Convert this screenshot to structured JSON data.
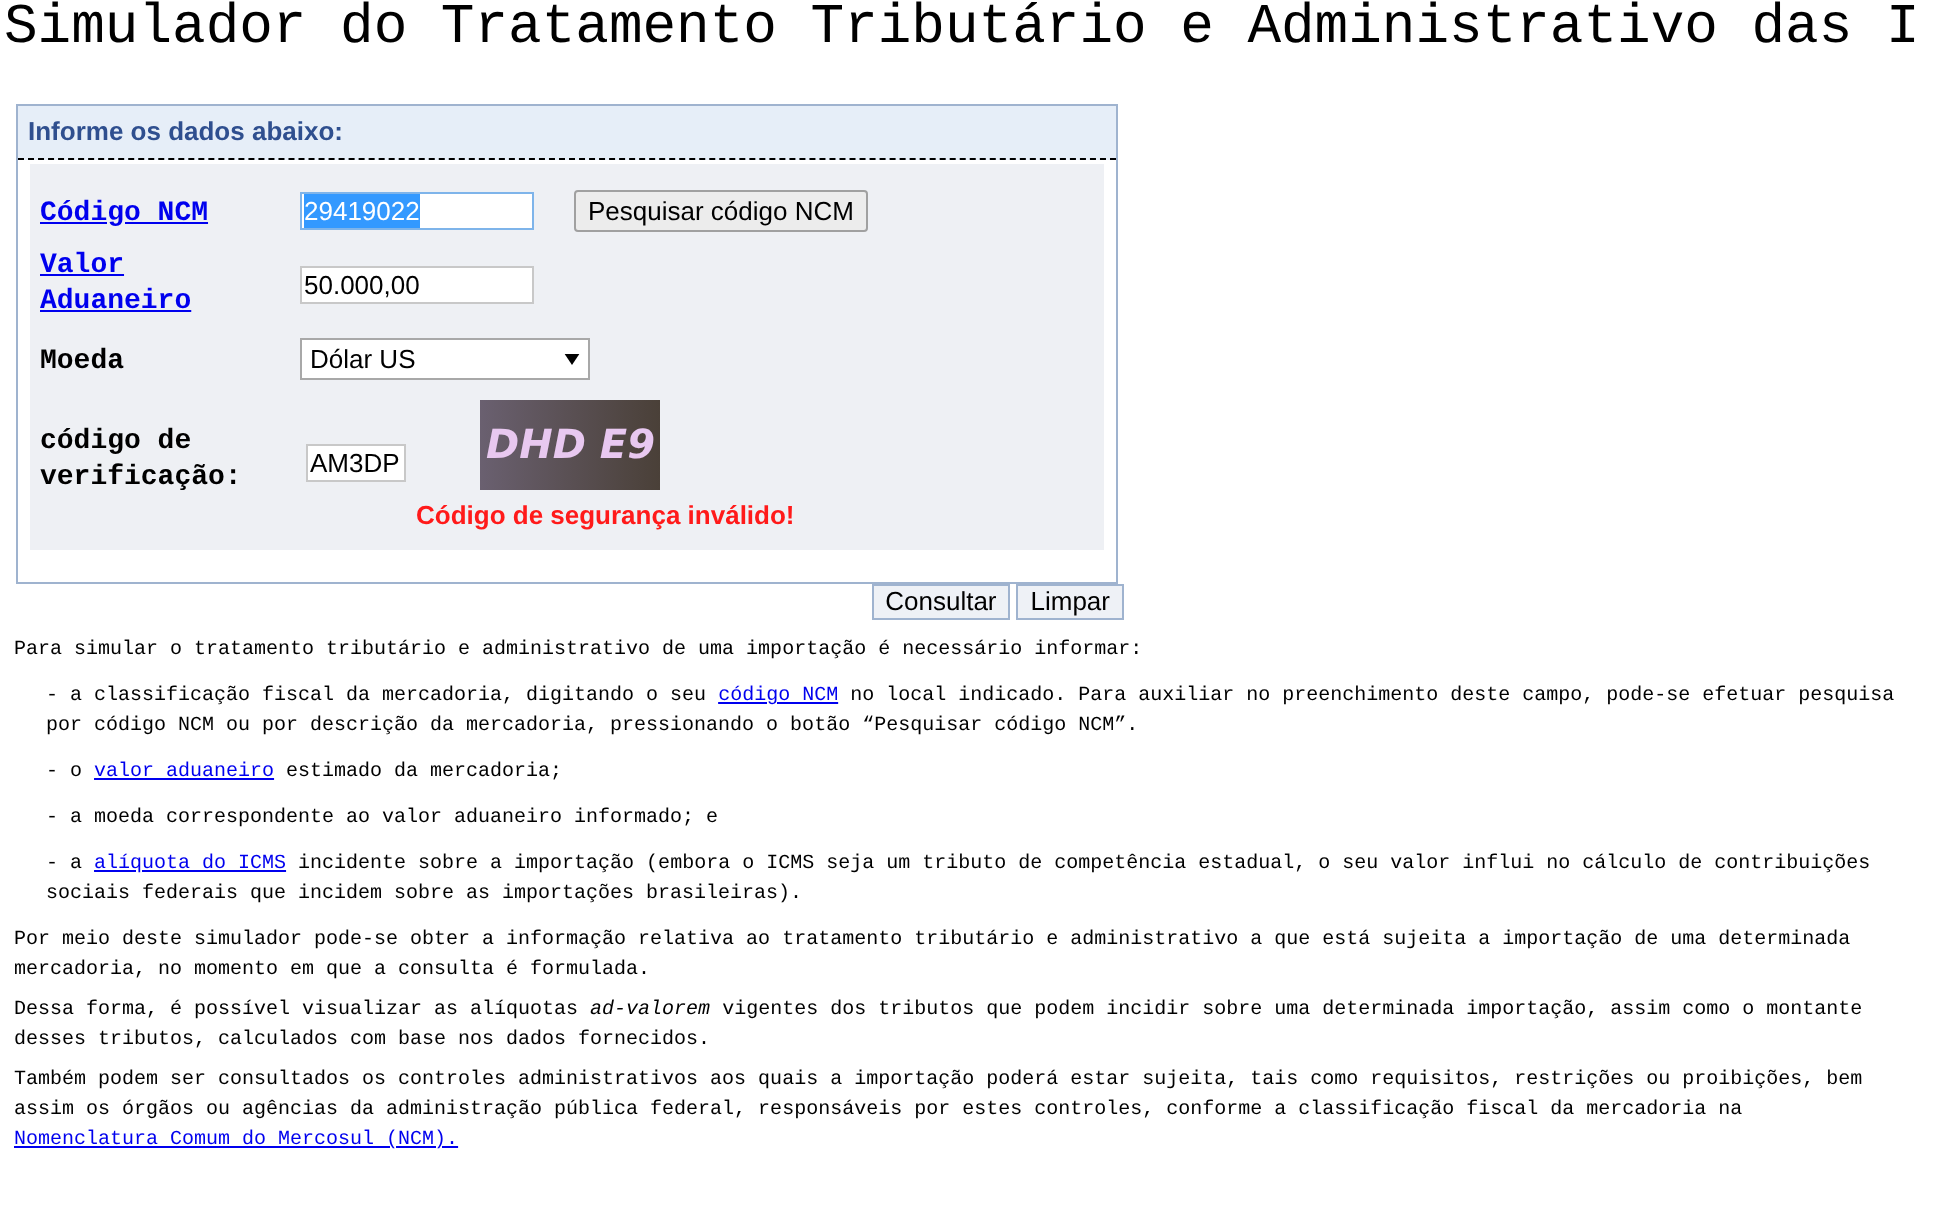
{
  "page_title": "Simulador do Tratamento Tributário e Administrativo das I",
  "form": {
    "header": "Informe os dados abaixo:",
    "fields": [
      {
        "kind": "text",
        "label": "Código NCM",
        "label_link": true,
        "value": "29419022",
        "selected": true,
        "button": "Pesquisar código NCM"
      },
      {
        "kind": "text",
        "label": "Valor Aduaneiro",
        "label_link": true,
        "value": "50.000,00",
        "selected": false
      },
      {
        "kind": "select",
        "label": "Moeda",
        "label_link": false,
        "value": "Dólar US"
      },
      {
        "kind": "captcha",
        "label": "código de verificação:",
        "label_link": false,
        "value": "AM3DP",
        "captcha_text": "DHD E9",
        "error": "Código de segurança inválido!"
      }
    ]
  },
  "buttons": [
    "Consultar",
    "Limpar"
  ],
  "intro": [
    {
      "kind": "text",
      "text": "Para simular o tratamento tributário e administrativo de uma importação é necessário informar:"
    }
  ],
  "bullets": [
    [
      {
        "kind": "text",
        "text": "- a classificação fiscal da mercadoria, digitando o seu "
      },
      {
        "kind": "link",
        "text": "código NCM"
      },
      {
        "kind": "text",
        "text": " no local indicado. Para auxiliar no preenchimento deste campo, pode-se efetuar pesquisa por código NCM ou por descrição da mercadoria, pressionando o botão “Pesquisar código NCM”."
      }
    ],
    [
      {
        "kind": "text",
        "text": "- o "
      },
      {
        "kind": "link",
        "text": "valor aduaneiro"
      },
      {
        "kind": "text",
        "text": " estimado da mercadoria;"
      }
    ],
    [
      {
        "kind": "text",
        "text": "- a moeda correspondente ao valor aduaneiro informado; e"
      }
    ],
    [
      {
        "kind": "text",
        "text": "- a "
      },
      {
        "kind": "link",
        "text": "alíquota do ICMS"
      },
      {
        "kind": "text",
        "text": " incidente sobre a importação (embora o ICMS seja um tributo de competência estadual, o seu valor influi no cálculo de contribuições sociais federais que incidem sobre as importações brasileiras)."
      }
    ]
  ],
  "paragraphs": [
    [
      {
        "kind": "text",
        "text": "Por meio deste simulador pode-se obter a informação relativa ao tratamento tributário e administrativo a que está sujeita a importação de uma determinada mercadoria, no momento em que a consulta é formulada."
      }
    ],
    [
      {
        "kind": "text",
        "text": "Dessa forma, é possível visualizar as alíquotas *ad-valorem* vigentes dos tributos que podem incidir sobre uma determinada importação, assim como o montante desses tributos, calculados com base nos dados fornecidos."
      }
    ],
    [
      {
        "kind": "text",
        "text": "Também podem ser consultados os controles administrativos aos quais a importação poderá estar sujeita, tais como requisitos, restrições ou proibições, bem assim os órgãos ou agências da administração pública federal, responsáveis por estes controles, conforme a classificação fiscal da mercadoria na "
      },
      {
        "kind": "link",
        "text": "Nomenclatura Comum do Mercosul (NCM)."
      }
    ]
  ]
}
